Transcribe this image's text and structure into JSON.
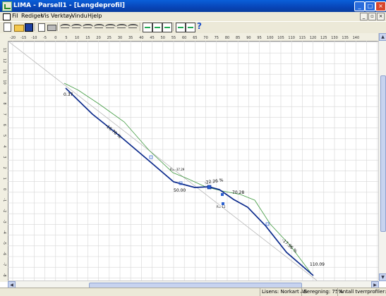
{
  "window": {
    "title": "LIMA - Parsell1 - [Lengdeprofil]",
    "controls": {
      "minimize": "_",
      "maximize": "□",
      "close": "×"
    }
  },
  "menubar": {
    "items": [
      "Fil",
      "Rediger",
      "Vis",
      "Verktøy",
      "Vindu",
      "Hjelp"
    ],
    "mdi_controls": {
      "minimize": "_",
      "restore": "▫",
      "close": "×"
    }
  },
  "toolbar": {
    "help_label": "?",
    "icons": [
      "new-icon",
      "open-icon",
      "save-icon",
      "preview-icon",
      "print-icon",
      "curve-icon",
      "curve-icon",
      "curve-icon",
      "curve-icon",
      "curve-icon",
      "curve-icon",
      "curve-icon",
      "curve-icon",
      "profile-view-icon",
      "cross-section-icon",
      "terrain-icon",
      "text-icon",
      "table-icon",
      "help-icon"
    ]
  },
  "rulers": {
    "x_ticks": [
      "-20",
      "-15",
      "-10",
      "-5",
      "0",
      "5",
      "10",
      "15",
      "20",
      "25",
      "30",
      "35",
      "40",
      "45",
      "50",
      "55",
      "60",
      "65",
      "70",
      "75",
      "80",
      "85",
      "90",
      "95",
      "100",
      "105",
      "110",
      "115",
      "120",
      "125",
      "130",
      "135",
      "140"
    ],
    "y_ticks": [
      "13",
      "12",
      "11",
      "10",
      "9",
      "8",
      "7",
      "6",
      "5",
      "4",
      "3",
      "2",
      "1",
      "0",
      "-1",
      "-2",
      "-3",
      "-4",
      "-5",
      "-6",
      "-7",
      "-8",
      "-9",
      "-10"
    ]
  },
  "profile": {
    "labels": {
      "start_value": "0.37",
      "grade_1": "-16.78 %",
      "grade_2": "-22.26 %",
      "grade_3": "-17.96 %",
      "low_point": "50.00",
      "mid_value": "70.28",
      "mid_value_2": "60.00",
      "end_value": "110.09",
      "curve_tag_1": "R= -37.29",
      "curve_tag_2": "R= 12",
      "vertex_tag": "R= 30"
    },
    "colors": {
      "road_line": "#0b2a8c",
      "terrain_line": "#3f9a3f",
      "reference_line": "#b8b8b8",
      "grid": "#d6d6d6"
    }
  },
  "statusbar": {
    "license": "Lisens: Norkart AS",
    "calculation": "Beregning: 75%",
    "cross_sections": "Antall tverrprofiler: 12"
  }
}
